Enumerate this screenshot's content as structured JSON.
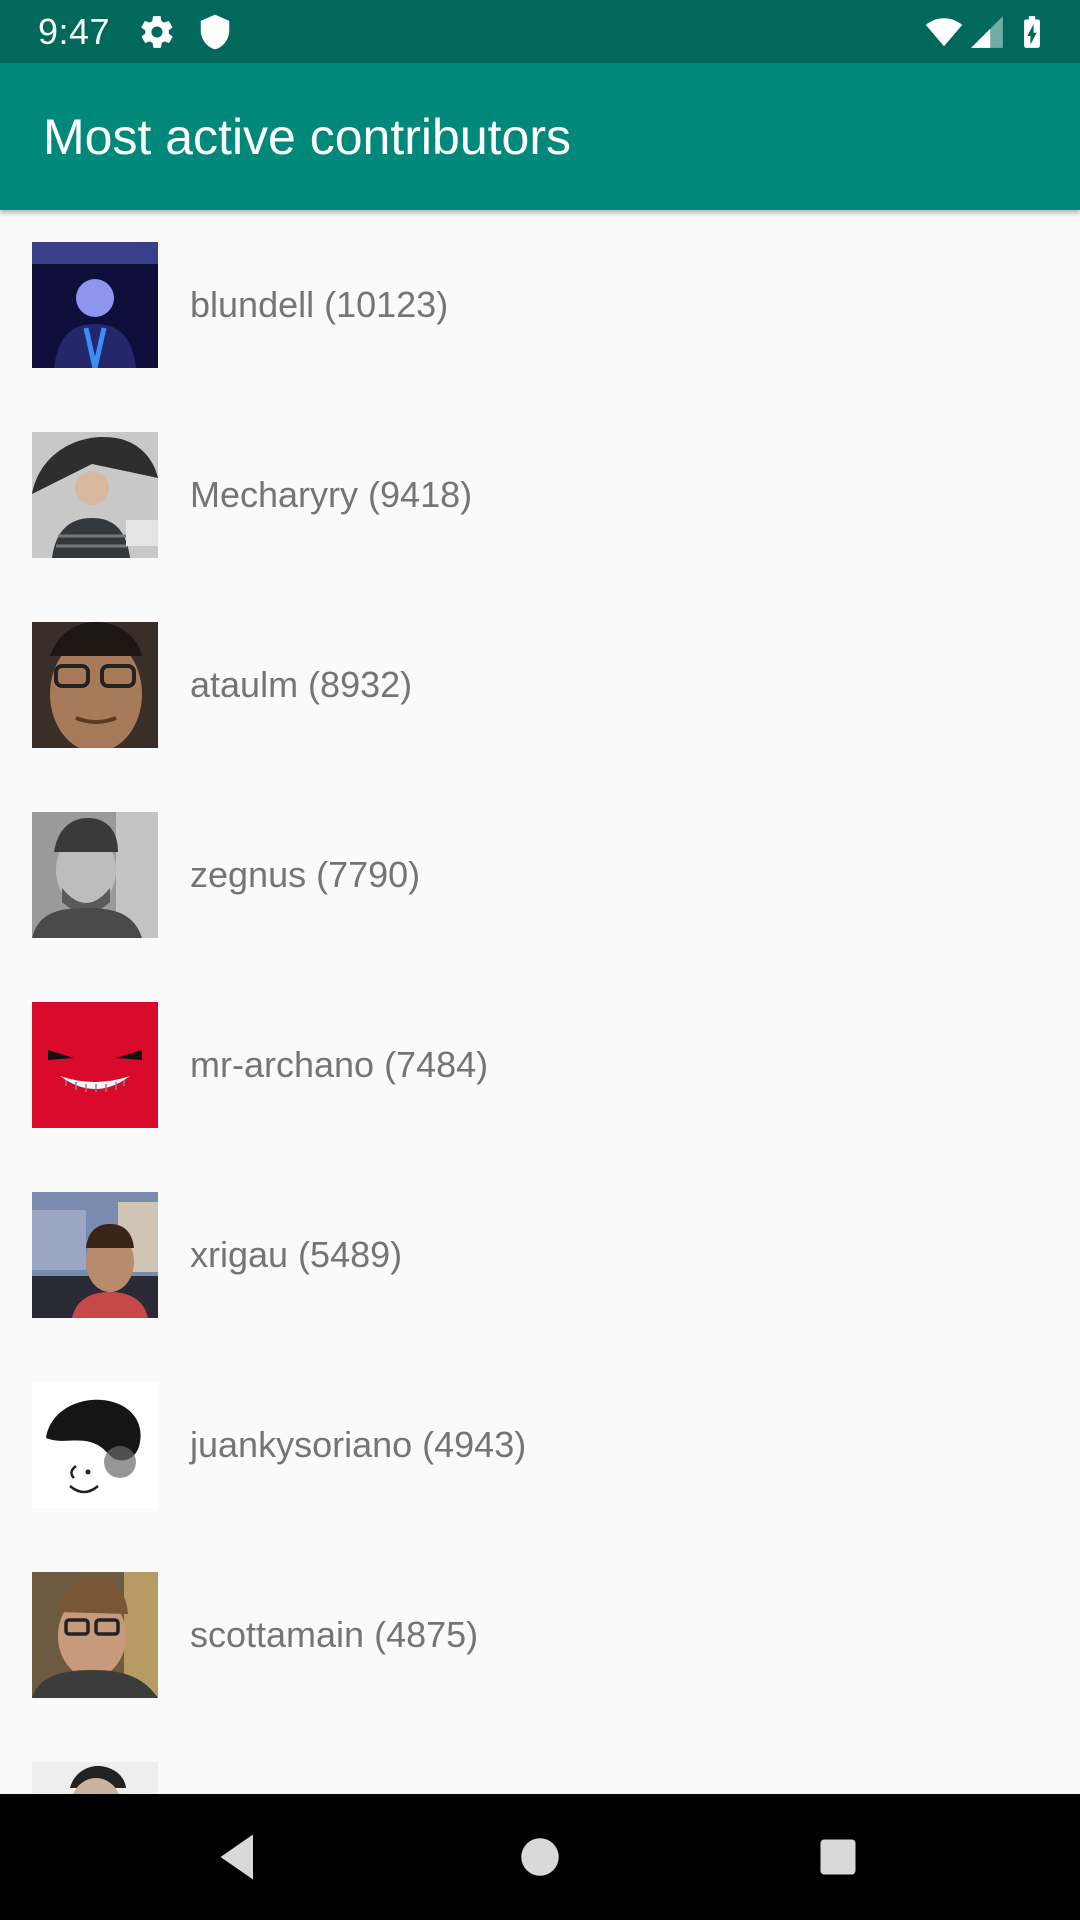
{
  "status_bar": {
    "time": "9:47",
    "icons": [
      "settings-icon",
      "shield-icon",
      "wifi-icon",
      "signal-icon",
      "battery-charging-icon"
    ],
    "background": "#00695c"
  },
  "app_bar": {
    "title": "Most active contributors",
    "background": "#00897b"
  },
  "contributors": [
    {
      "label": "blundell (10123)"
    },
    {
      "label": "Mecharyry (9418)"
    },
    {
      "label": "ataulm (8932)"
    },
    {
      "label": "zegnus (7790)"
    },
    {
      "label": "mr-archano (7484)"
    },
    {
      "label": "xrigau (5489)"
    },
    {
      "label": "juankysoriano (4943)"
    },
    {
      "label": "scottamain (4875)"
    }
  ],
  "nav_bar": {
    "buttons": [
      "back-icon",
      "home-icon",
      "recents-icon"
    ]
  }
}
